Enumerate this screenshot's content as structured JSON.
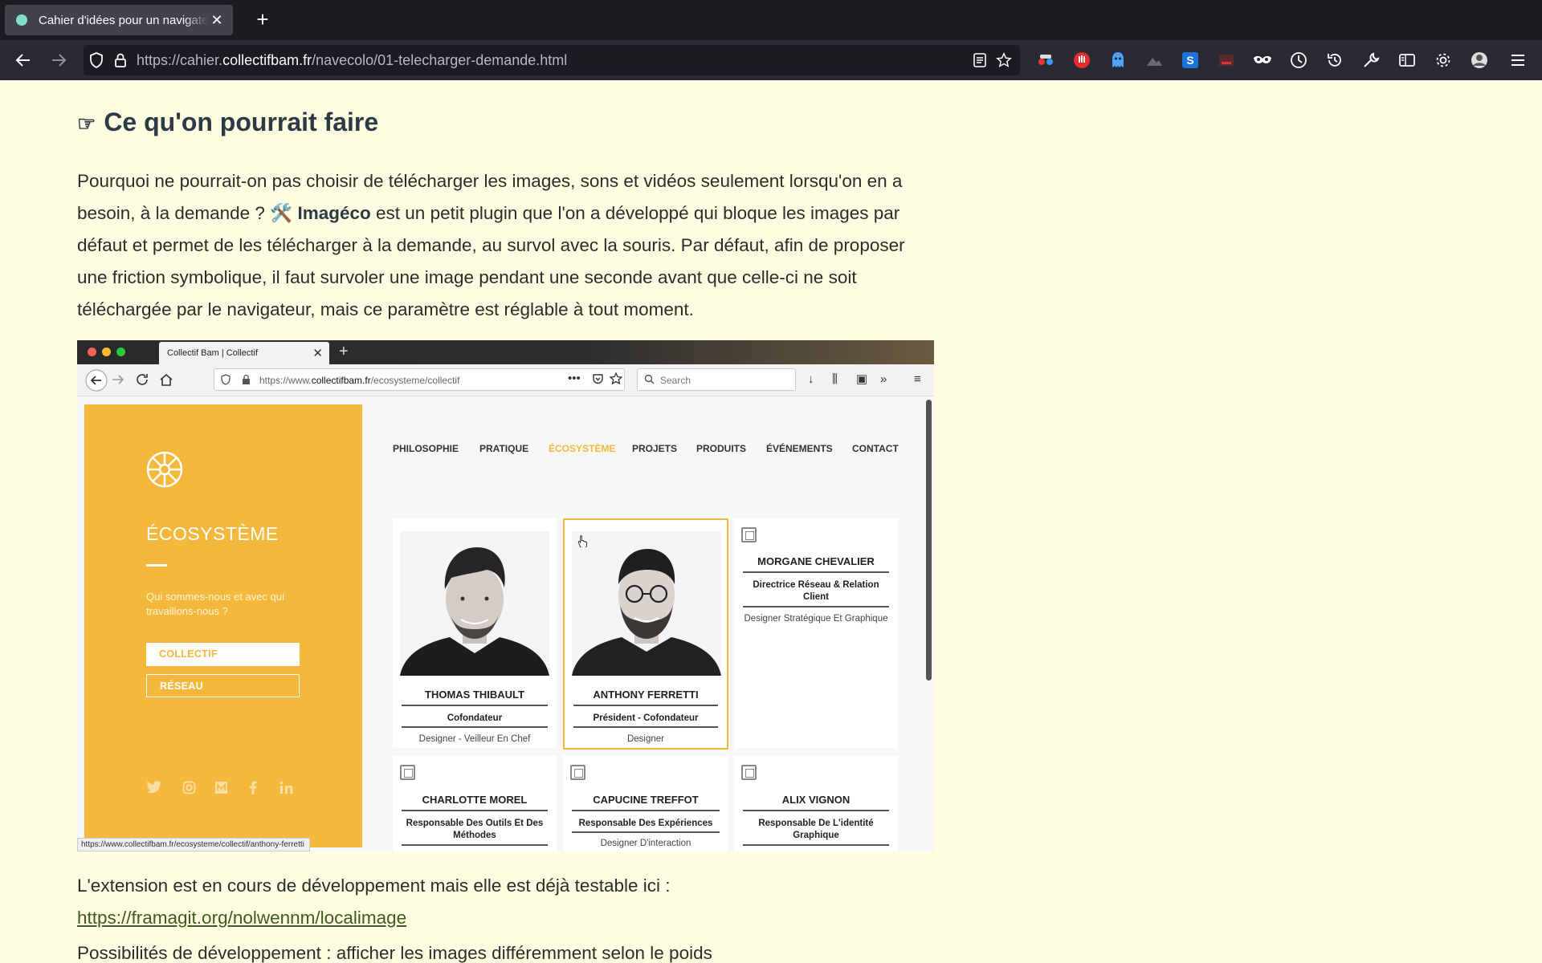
{
  "browser": {
    "tab_title": "Cahier d'idées pour un navigateur",
    "url_prefix": "https://cahier.",
    "url_domain": "collectifbam.fr",
    "url_path": "/navecolo/01-telecharger-demande.html"
  },
  "article": {
    "heading_icon": "☞",
    "heading": "Ce qu'on pourrait faire",
    "para_start": "Pourquoi ne pourrait-on pas choisir de télécharger les images, sons et vidéos seulement lorsqu'on en a besoin, à la demande ?",
    "tool_icon": "🛠️",
    "plugin_name": "Imagéco",
    "para_end": "est un petit plugin que l'on a développé qui bloque les images par défaut et permet de les télécharger à la demande, au survol avec la souris. Par défaut, afin de proposer une friction symbolique, il faut survoler une image pendant une seconde avant que celle-ci ne soit téléchargée par le navigateur, mais ce paramètre est réglable à tout moment.",
    "after_text": "L'extension est en cours de développement mais elle est déjà testable ici :",
    "after_link": "https://framagit.org/nolwennm/localimage",
    "cut_text": "Possibilités de développement : afficher les images différemment selon le poids"
  },
  "screenshot": {
    "tab_title": "Collectif Bam | Collectif",
    "url_prefix": "https://www.",
    "url_domain": "collectifbam.fr",
    "url_path": "/ecosysteme/collectif",
    "search_placeholder": "Search",
    "sidebar_title": "ÉCOSYSTÈME",
    "sidebar_question": "Qui sommes-nous et avec qui travaillons-nous ?",
    "btn_collectif": "COLLECTIF",
    "btn_reseau": "RÉSEAU",
    "menu": [
      "PHILOSOPHIE",
      "PRATIQUE",
      "ÉCOSYSTÈME",
      "PROJETS",
      "PRODUITS",
      "ÉVÉNEMENTS",
      "CONTACT"
    ],
    "people": [
      {
        "name": "THOMAS THIBAULT",
        "role": "Cofondateur",
        "desc": "Designer - Veilleur En Chef"
      },
      {
        "name": "ANTHONY FERRETTI",
        "role": "Président - Cofondateur",
        "desc": "Designer"
      },
      {
        "name": "MORGANE CHEVALIER",
        "role": "Directrice Réseau & Relation Client",
        "desc": "Designer Stratégique Et Graphique"
      },
      {
        "name": "CHARLOTTE MOREL",
        "role": "Responsable Des Outils Et Des Méthodes",
        "desc": ""
      },
      {
        "name": "CAPUCINE TREFFOT",
        "role": "Responsable Des Expériences",
        "desc": "Designer D'interaction"
      },
      {
        "name": "ALIX VIGNON",
        "role": "Responsable De L'identité Graphique",
        "desc": ""
      }
    ],
    "status_url": "https://www.collectifbam.fr/ecosysteme/collectif/anthony-ferretti"
  },
  "colors": {
    "page_bg": "#fffde1",
    "heading": "#2b3a45",
    "accent_yellow": "#f4b83c",
    "link": "#3f5a1f"
  }
}
